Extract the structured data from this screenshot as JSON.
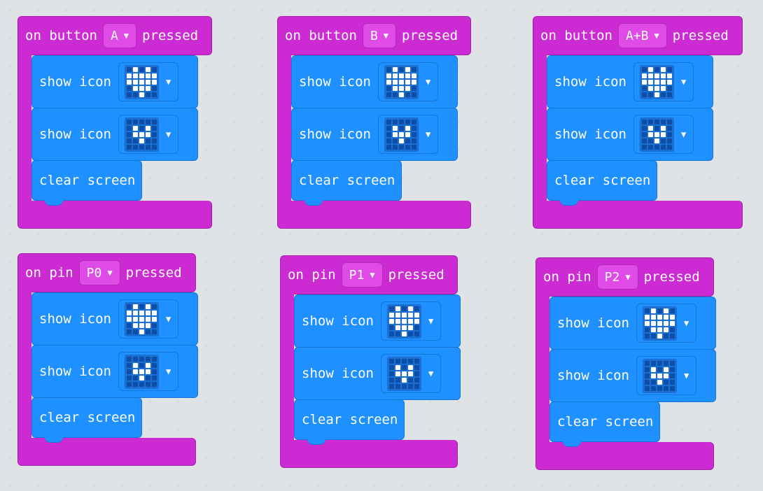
{
  "colors": {
    "event_block": "#cc2bd3",
    "basic_block": "#1e90ff",
    "background": "#eceff1"
  },
  "icons": {
    "heart": [
      [
        0,
        1,
        0,
        1,
        0
      ],
      [
        1,
        1,
        1,
        1,
        1
      ],
      [
        1,
        1,
        1,
        1,
        1
      ],
      [
        0,
        1,
        1,
        1,
        0
      ],
      [
        0,
        0,
        1,
        0,
        0
      ]
    ],
    "small_heart": [
      [
        0,
        0,
        0,
        0,
        0
      ],
      [
        0,
        1,
        0,
        1,
        0
      ],
      [
        0,
        1,
        1,
        1,
        0
      ],
      [
        0,
        0,
        1,
        0,
        0
      ],
      [
        0,
        0,
        0,
        0,
        0
      ]
    ]
  },
  "events": [
    {
      "prefix": "on button",
      "value": "A",
      "suffix": "pressed",
      "blocks": [
        {
          "label": "show icon",
          "icon": "heart"
        },
        {
          "label": "show icon",
          "icon": "small_heart"
        },
        {
          "label": "clear screen"
        }
      ]
    },
    {
      "prefix": "on button",
      "value": "B",
      "suffix": "pressed",
      "blocks": [
        {
          "label": "show icon",
          "icon": "heart"
        },
        {
          "label": "show icon",
          "icon": "small_heart"
        },
        {
          "label": "clear screen"
        }
      ]
    },
    {
      "prefix": "on button",
      "value": "A+B",
      "suffix": "pressed",
      "blocks": [
        {
          "label": "show icon",
          "icon": "heart"
        },
        {
          "label": "show icon",
          "icon": "small_heart"
        },
        {
          "label": "clear screen"
        }
      ]
    },
    {
      "prefix": "on pin",
      "value": "P0",
      "suffix": "pressed",
      "blocks": [
        {
          "label": "show icon",
          "icon": "heart"
        },
        {
          "label": "show icon",
          "icon": "small_heart"
        },
        {
          "label": "clear screen"
        }
      ]
    },
    {
      "prefix": "on pin",
      "value": "P1",
      "suffix": "pressed",
      "blocks": [
        {
          "label": "show icon",
          "icon": "heart"
        },
        {
          "label": "show icon",
          "icon": "small_heart"
        },
        {
          "label": "clear screen"
        }
      ]
    },
    {
      "prefix": "on pin",
      "value": "P2",
      "suffix": "pressed",
      "blocks": [
        {
          "label": "show icon",
          "icon": "heart"
        },
        {
          "label": "show icon",
          "icon": "small_heart"
        },
        {
          "label": "clear screen"
        }
      ]
    }
  ]
}
